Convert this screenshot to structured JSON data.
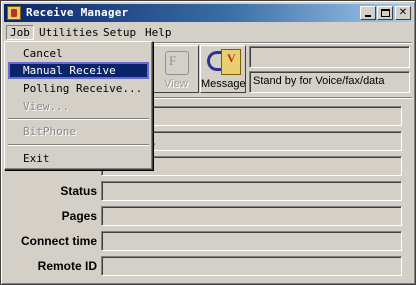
{
  "window": {
    "title": "Receive Manager"
  },
  "menubar": {
    "items": [
      {
        "label": "Job"
      },
      {
        "label": "Utilities"
      },
      {
        "label": "Setup"
      },
      {
        "label": "Help"
      }
    ]
  },
  "job_menu": {
    "items": [
      {
        "label": "Cancel",
        "state": "enabled"
      },
      {
        "label": "Manual Receive",
        "state": "selected"
      },
      {
        "label": "Polling Receive...",
        "state": "enabled"
      },
      {
        "label": "View...",
        "state": "disabled"
      },
      {
        "label": "BitPhone",
        "state": "disabled"
      },
      {
        "label": "Exit",
        "state": "enabled"
      }
    ]
  },
  "toolbar": {
    "view_label": "View",
    "view_icon": "fax-view-icon",
    "message_label": "Message",
    "message_icon": "voice-message-icon"
  },
  "status_top": {
    "text": "Stand by for Voice/fax/data"
  },
  "fields": {
    "row2_value": "for call...",
    "status_label": "Status",
    "pages_label": "Pages",
    "connect_time_label": "Connect time",
    "remote_id_label": "Remote ID"
  },
  "colors": {
    "titlebar_start": "#0a246a",
    "titlebar_end": "#a6caf0",
    "selection": "#0a246a",
    "face": "#d4d0c8"
  }
}
